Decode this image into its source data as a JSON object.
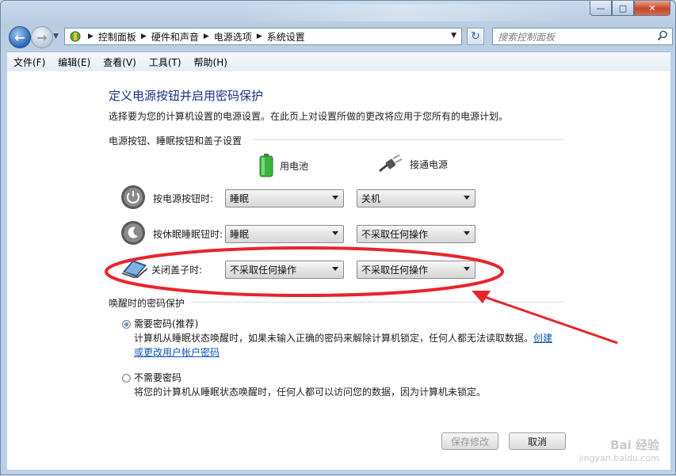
{
  "window": {
    "caption": {
      "minimize": "—",
      "maximize": "□",
      "close": "✕"
    }
  },
  "nav": {
    "back_icon": "back-arrow-icon",
    "forward_icon": "forward-arrow-icon",
    "breadcrumb": [
      "控制面板",
      "硬件和声音",
      "电源选项",
      "系统设置"
    ],
    "search_placeholder": "搜索控制面板"
  },
  "menubar": [
    "文件(F)",
    "编辑(E)",
    "查看(V)",
    "工具(T)",
    "帮助(H)"
  ],
  "page": {
    "title": "定义电源按钮并启用密码保护",
    "description": "选择要为您的计算机设置的电源设置。在此页上对设置所做的更改将应用于您所有的电源计划。",
    "section_buttons": "电源按钮、睡眠按钮和盖子设置",
    "col_battery": "用电池",
    "col_plugged": "接通电源",
    "rows": [
      {
        "label": "按电源按钮时:",
        "battery": "睡眠",
        "plugged": "关机"
      },
      {
        "label": "按休眠睡眠钮时:",
        "battery": "睡眠",
        "plugged": "不采取任何操作"
      },
      {
        "label": "关闭盖子时:",
        "battery": "不采取任何操作",
        "plugged": "不采取任何操作"
      }
    ],
    "section_password": "唤醒时的密码保护",
    "opt_require_title": "需要密码(推荐)",
    "opt_require_text": "计算机从睡眠状态唤醒时，如果未输入正确的密码来解除计算机锁定，任何人都无法读取数据。",
    "opt_require_link": "创建或更改用户帐户密码",
    "opt_norequire_title": "不需要密码",
    "opt_norequire_text": "将您的计算机从睡眠状态唤醒时，任何人都可以访问您的数据，因为计算机未锁定。",
    "save_button": "保存修改",
    "cancel_button": "取消",
    "selected_option": "require"
  },
  "annotation": {
    "color": "#e8242b"
  },
  "watermark": {
    "line1": "Bai 经验",
    "line2": "jingyan.baidu.com"
  }
}
